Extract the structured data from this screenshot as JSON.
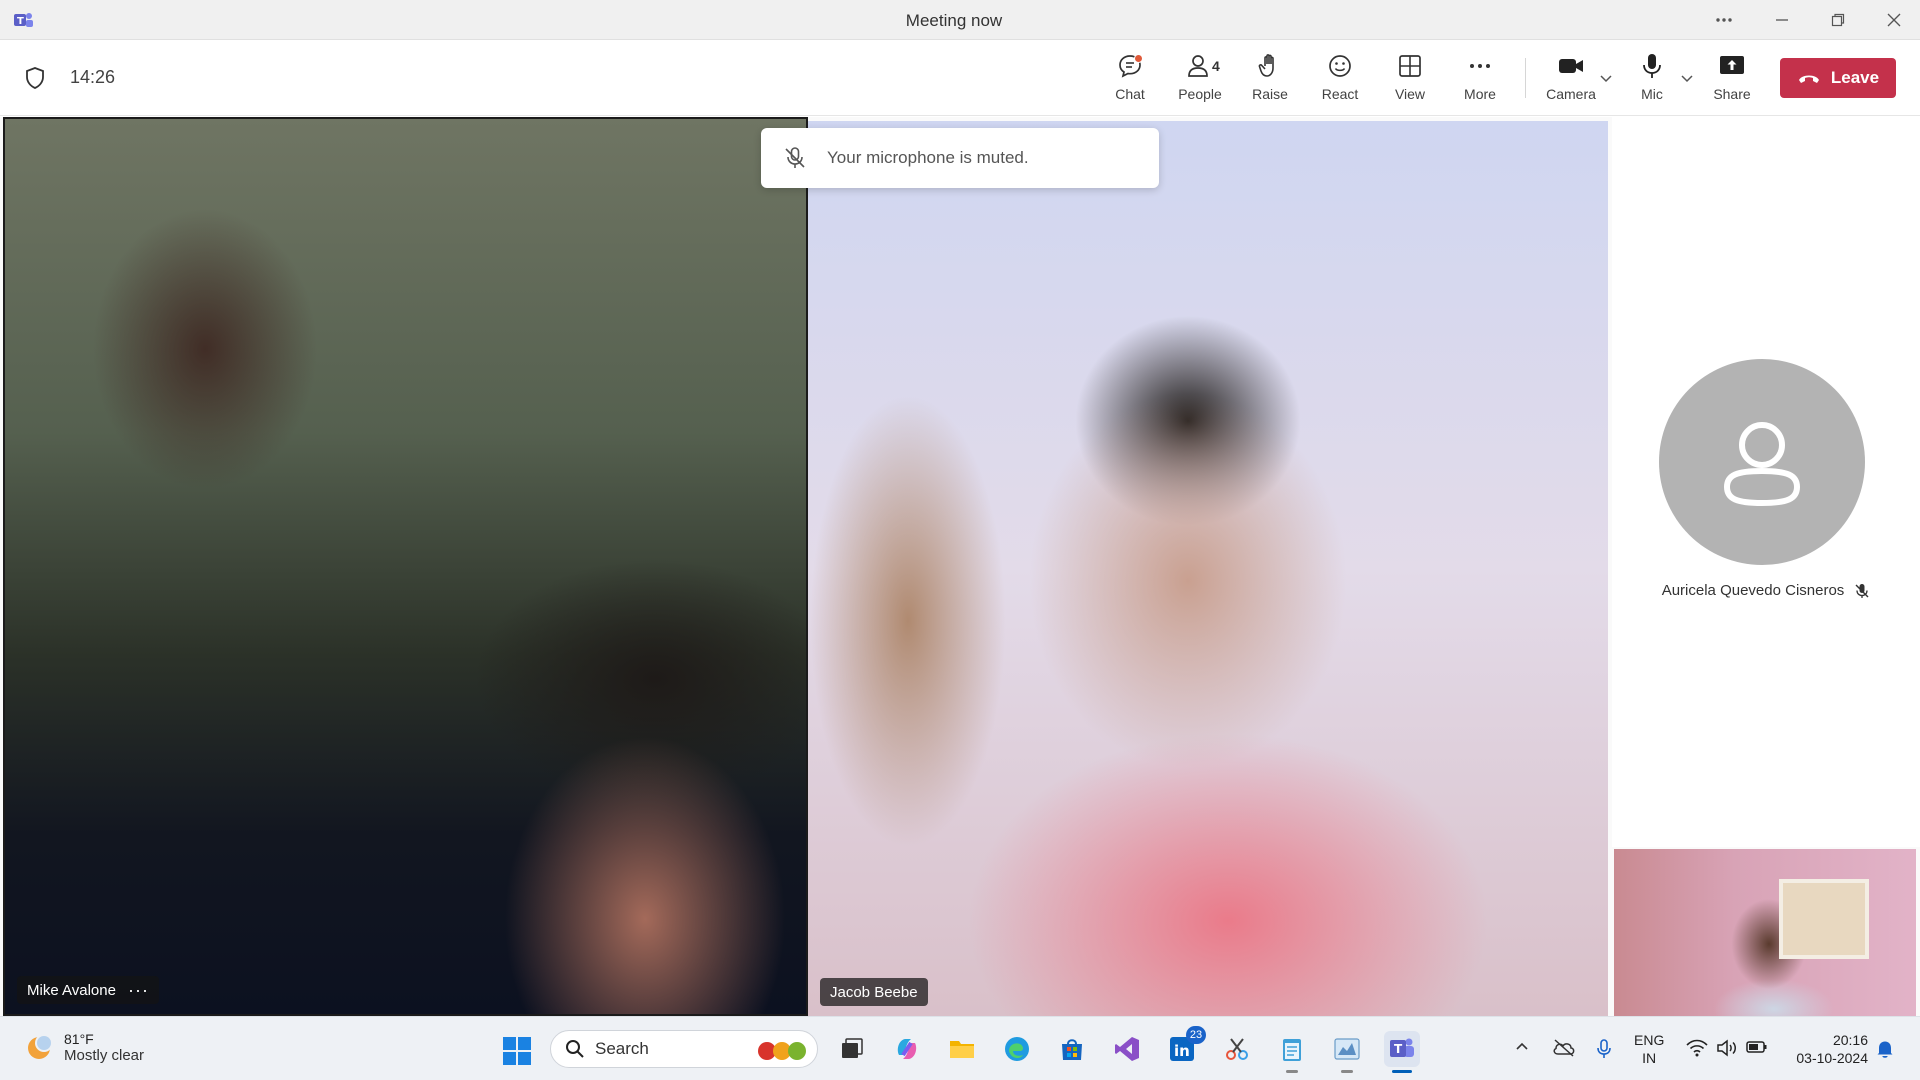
{
  "window": {
    "title": "Meeting now"
  },
  "toolbar": {
    "timer": "14:26",
    "buttons": {
      "chat": "Chat",
      "people": "People",
      "people_count": "4",
      "raise": "Raise",
      "react": "React",
      "view": "View",
      "more": "More",
      "camera": "Camera",
      "mic": "Mic",
      "share": "Share"
    },
    "leave_label": "Leave",
    "colors": {
      "leave": "#c4314b",
      "notification_dot": "#e05a3a"
    }
  },
  "toast": {
    "message": "Your microphone is muted."
  },
  "participants": {
    "tile1_name": "Mike Avalone",
    "tile1_more": "···",
    "tile2_name": "Jacob Beebe",
    "side_name": "Auricela Quevedo Cisneros"
  },
  "taskbar": {
    "weather_temp": "81°F",
    "weather_desc": "Mostly clear",
    "search_label": "Search",
    "linkedin_badge": "23",
    "lang_line1": "ENG",
    "lang_line2": "IN",
    "time": "20:16",
    "date": "03-10-2024"
  }
}
